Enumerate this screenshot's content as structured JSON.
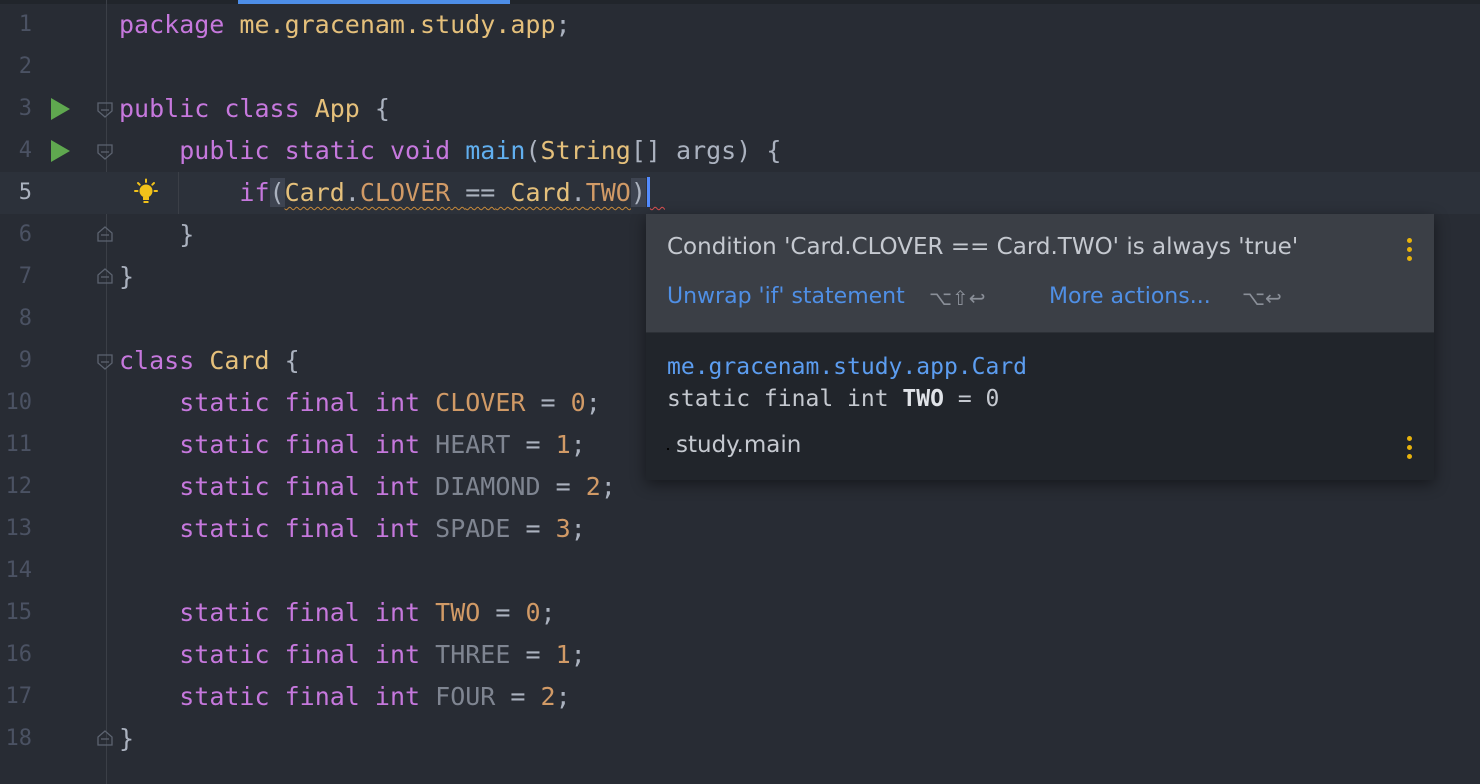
{
  "editor": {
    "line_numbers": [
      "1",
      "2",
      "3",
      "4",
      "5",
      "6",
      "7",
      "8",
      "9",
      "10",
      "11",
      "12",
      "13",
      "14",
      "15",
      "16",
      "17",
      "18"
    ],
    "tokens": {
      "package": "package",
      "pkg_name": "me.gracenam.study.app",
      "semicolon": ";",
      "public": "public",
      "class": "class",
      "static": "static",
      "void": "void",
      "final": "final",
      "int": "int",
      "if": "if",
      "App": "App",
      "Card": "Card",
      "main": "main",
      "String": "String",
      "args": "args",
      "open_brace": "{",
      "close_brace": "}",
      "eq": "=",
      "eqeq": "==",
      "dot": ".",
      "brackets": "[]",
      "lparen": "(",
      "rparen": ")"
    },
    "constants": [
      {
        "name": "CLOVER",
        "value": "0"
      },
      {
        "name": "HEART",
        "value": "1"
      },
      {
        "name": "DIAMOND",
        "value": "2"
      },
      {
        "name": "SPADE",
        "value": "3"
      },
      {
        "name": "TWO",
        "value": "0"
      },
      {
        "name": "THREE",
        "value": "1"
      },
      {
        "name": "FOUR",
        "value": "2"
      }
    ]
  },
  "popup": {
    "message": "Condition 'Card.CLOVER == Card.TWO' is always 'true'",
    "action1": "Unwrap 'if' statement",
    "action1_shortcut": "⌥⇧↩",
    "action2": "More actions...",
    "action2_shortcut": "⌥↩",
    "fqn": "me.gracenam.study.app.Card",
    "decl_prefix": "static final int",
    "decl_name": "TWO",
    "decl_suffix": "= 0",
    "module": "study.main"
  },
  "colors": {
    "background": "#282c34",
    "keyword": "#c678dd",
    "type": "#e5c07b",
    "method": "#61afef",
    "number": "#d19a66",
    "link": "#4f8fe5",
    "run_icon": "#5fa84f",
    "kebab": "#e8b30c"
  }
}
